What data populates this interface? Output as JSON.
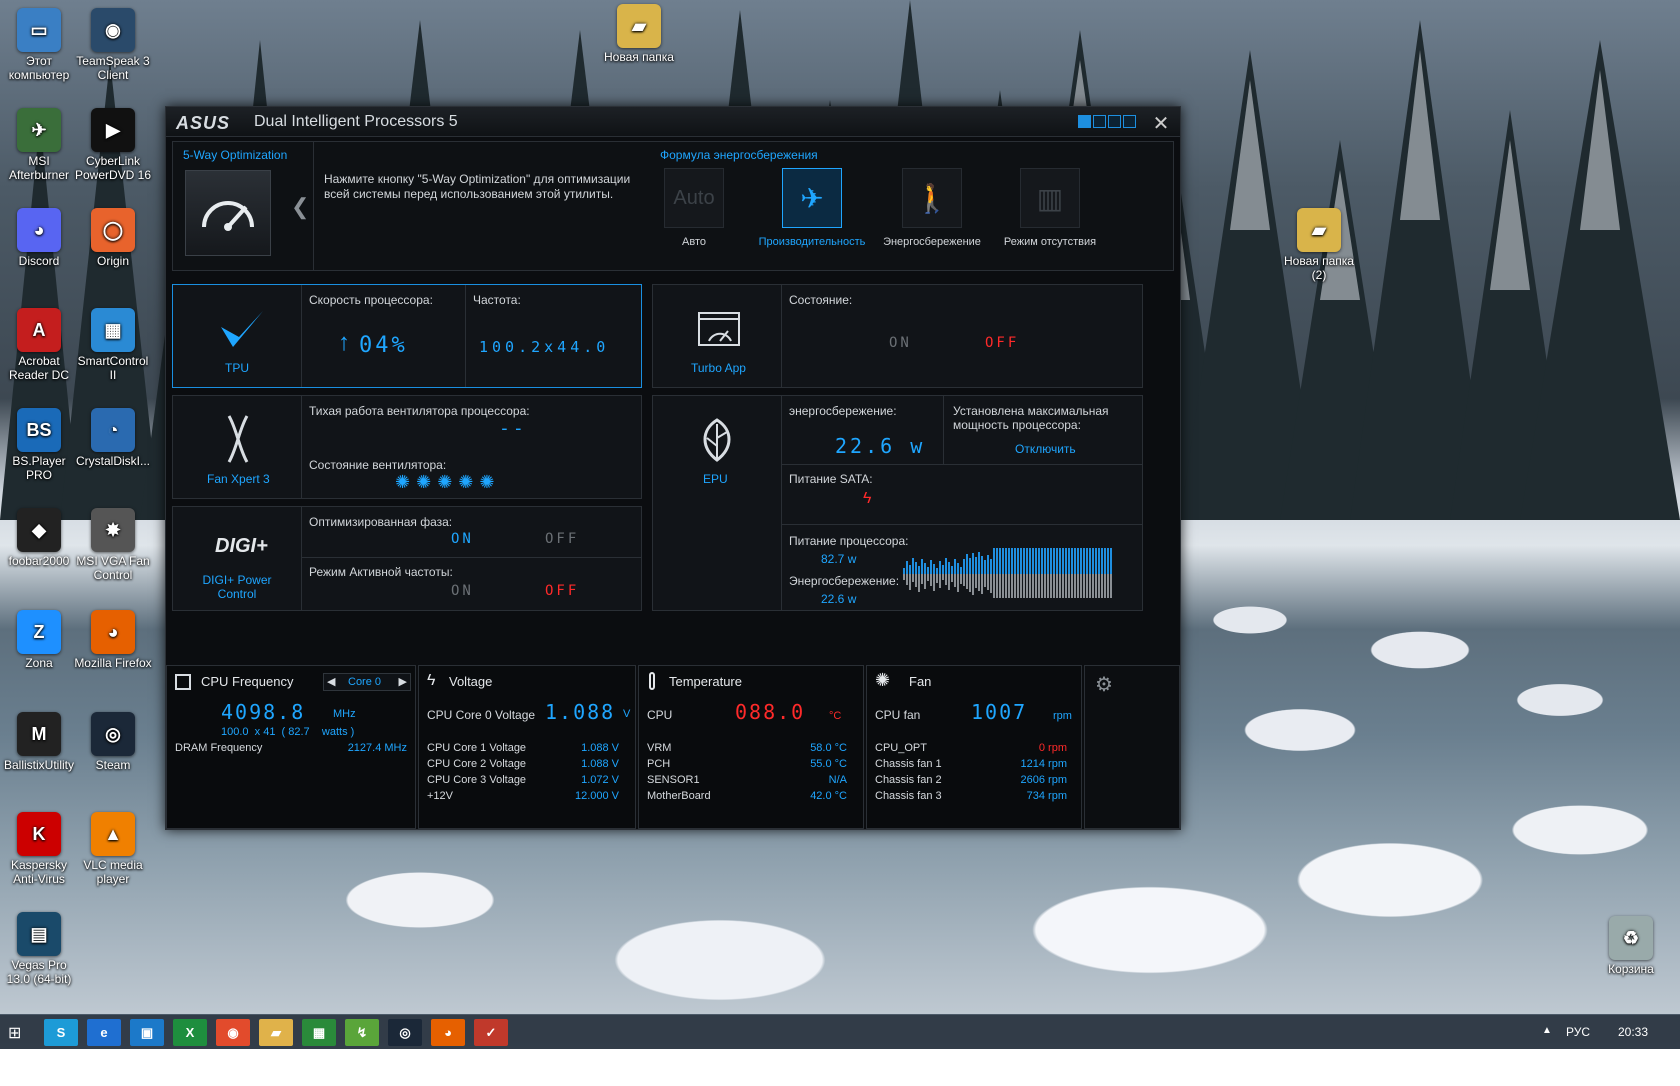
{
  "desktop": {
    "icons": [
      {
        "label": "Этот компьютер",
        "color": "#3a7fc4",
        "glyph": "▭"
      },
      {
        "label": "TeamSpeak 3 Client",
        "color": "#2a4a6a",
        "glyph": "◉"
      },
      {
        "label": "MSI Afterburner",
        "color": "#3a6e3a",
        "glyph": "✈"
      },
      {
        "label": "CyberLink PowerDVD 16",
        "color": "#111",
        "glyph": "▶"
      },
      {
        "label": "Discord",
        "color": "#5865f2",
        "glyph": "◕"
      },
      {
        "label": "Origin",
        "color": "#e8632c",
        "glyph": "◯"
      },
      {
        "label": "Acrobat Reader DC",
        "color": "#c41e1e",
        "glyph": "A"
      },
      {
        "label": "SmartControl II",
        "color": "#2a8ad4",
        "glyph": "▦"
      },
      {
        "label": "BS.Player PRO",
        "color": "#1a6ab8",
        "glyph": "BS"
      },
      {
        "label": "CrystalDiskI...",
        "color": "#2a6ab0",
        "glyph": "◔"
      },
      {
        "label": "foobar2000",
        "color": "#222",
        "glyph": "◆"
      },
      {
        "label": "MSI VGA Fan Control",
        "color": "#555",
        "glyph": "✸"
      },
      {
        "label": "Zona",
        "color": "#1e90ff",
        "glyph": "Z"
      },
      {
        "label": "Mozilla Firefox",
        "color": "#e66000",
        "glyph": "◕"
      },
      {
        "label": "BallistixUtility",
        "color": "#222",
        "glyph": "M"
      },
      {
        "label": "Steam",
        "color": "#1b2838",
        "glyph": "◎"
      },
      {
        "label": "Kaspersky Anti-Virus",
        "color": "#c00",
        "glyph": "K"
      },
      {
        "label": "VLC media player",
        "color": "#f08000",
        "glyph": "▲"
      },
      {
        "label": "Vegas Pro 13.0 (64-bit)",
        "color": "#1a4a6a",
        "glyph": "▤"
      },
      {
        "label": "Новая папка",
        "color": "#d9b44a",
        "glyph": "▰"
      },
      {
        "label": "Новая папка (2)",
        "color": "#d9b44a",
        "glyph": "▰"
      },
      {
        "label": "Корзина",
        "color": "#9aa",
        "glyph": "♻"
      }
    ]
  },
  "window": {
    "logo": "ASUS",
    "title": "Dual Intelligent Processors 5",
    "close": "✕"
  },
  "optimization": {
    "label": "5-Way Optimization",
    "hint": "Нажмите кнопку \"5-Way Optimization\" для оптимизации всей системы перед использованием этой утилиты.",
    "formula_title": "Формула энергосбережения",
    "modes": [
      {
        "label": "Авто",
        "glyph": "Auto"
      },
      {
        "label": "Производительность",
        "glyph": "✈"
      },
      {
        "label": "Энергосбережение",
        "glyph": "🚶"
      },
      {
        "label": "Режим отсутствия",
        "glyph": "▥"
      }
    ],
    "active_mode": "Производительность"
  },
  "tpu": {
    "name": "TPU",
    "speed_label": "Скорость процессора:",
    "speed_value": "04%",
    "freq_label": "Частота:",
    "freq_value": "100.2x44.0"
  },
  "turbo": {
    "name": "Turbo App",
    "state_label": "Состояние:",
    "on": "ON",
    "off": "OFF"
  },
  "fan": {
    "name": "Fan Xpert 3",
    "quiet_label": "Тихая работа вентилятора процессора:",
    "quiet_value": "--",
    "state_label": "Состояние вентилятора:"
  },
  "epu": {
    "name": "EPU",
    "saving_label": "энергосбережение:",
    "saving_value": "22.6 w",
    "max_label": "Установлена максимальная мощность процессора:",
    "disable_link": "Отключить",
    "sata_label": "Питание SATA:",
    "cpu_power_label": "Питание процессора:",
    "cpu_power_value": "82.7 w",
    "saving2_label": "Энергосбережение:",
    "saving2_value": "22.6 w"
  },
  "digi": {
    "logo": "DIGI+",
    "name": "DIGI+ Power Control",
    "phase_label": "Оптимизированная фаза:",
    "active_freq_label": "Режим Активной частоты:",
    "on": "ON",
    "off": "OFF"
  },
  "monitor": {
    "cpu": {
      "title": "CPU Frequency",
      "core": "Core 0",
      "value": "4098.8",
      "unit": "MHz",
      "sub": "100.0  x 41  ( 82.7    watts )",
      "dram_label": "DRAM Frequency",
      "dram_value": "2127.4  MHz"
    },
    "voltage": {
      "title": "Voltage",
      "main_label": "CPU Core 0 Voltage",
      "main_value": "1.088",
      "unit": "V",
      "rows": [
        {
          "label": "CPU Core 1 Voltage",
          "value": "1.088  V"
        },
        {
          "label": "CPU Core 2 Voltage",
          "value": "1.088  V"
        },
        {
          "label": "CPU Core 3 Voltage",
          "value": "1.072  V"
        },
        {
          "label": "+12V",
          "value": "12.000  V"
        }
      ]
    },
    "temperature": {
      "title": "Temperature",
      "main_label": "CPU",
      "main_value": "088.0",
      "unit": "°C",
      "rows": [
        {
          "label": "VRM",
          "value": "58.0 °C"
        },
        {
          "label": "PCH",
          "value": "55.0 °C"
        },
        {
          "label": "SENSOR1",
          "value": "N/A"
        },
        {
          "label": "MotherBoard",
          "value": "42.0 °C"
        }
      ]
    },
    "fan": {
      "title": "Fan",
      "main_label": "CPU fan",
      "main_value": "1007",
      "unit": "rpm",
      "rows": [
        {
          "label": "CPU_OPT",
          "value": "0  rpm"
        },
        {
          "label": "Chassis fan 1",
          "value": "1214  rpm"
        },
        {
          "label": "Chassis fan 2",
          "value": "2606  rpm"
        },
        {
          "label": "Chassis fan 3",
          "value": "734  rpm"
        }
      ]
    }
  },
  "taskbar": {
    "lang": "РУС",
    "time": "20:33",
    "apps": [
      "S",
      "e",
      "▣",
      "X",
      "◉",
      "▰",
      "▦",
      "↯",
      "◎",
      "◕",
      "✓"
    ]
  }
}
